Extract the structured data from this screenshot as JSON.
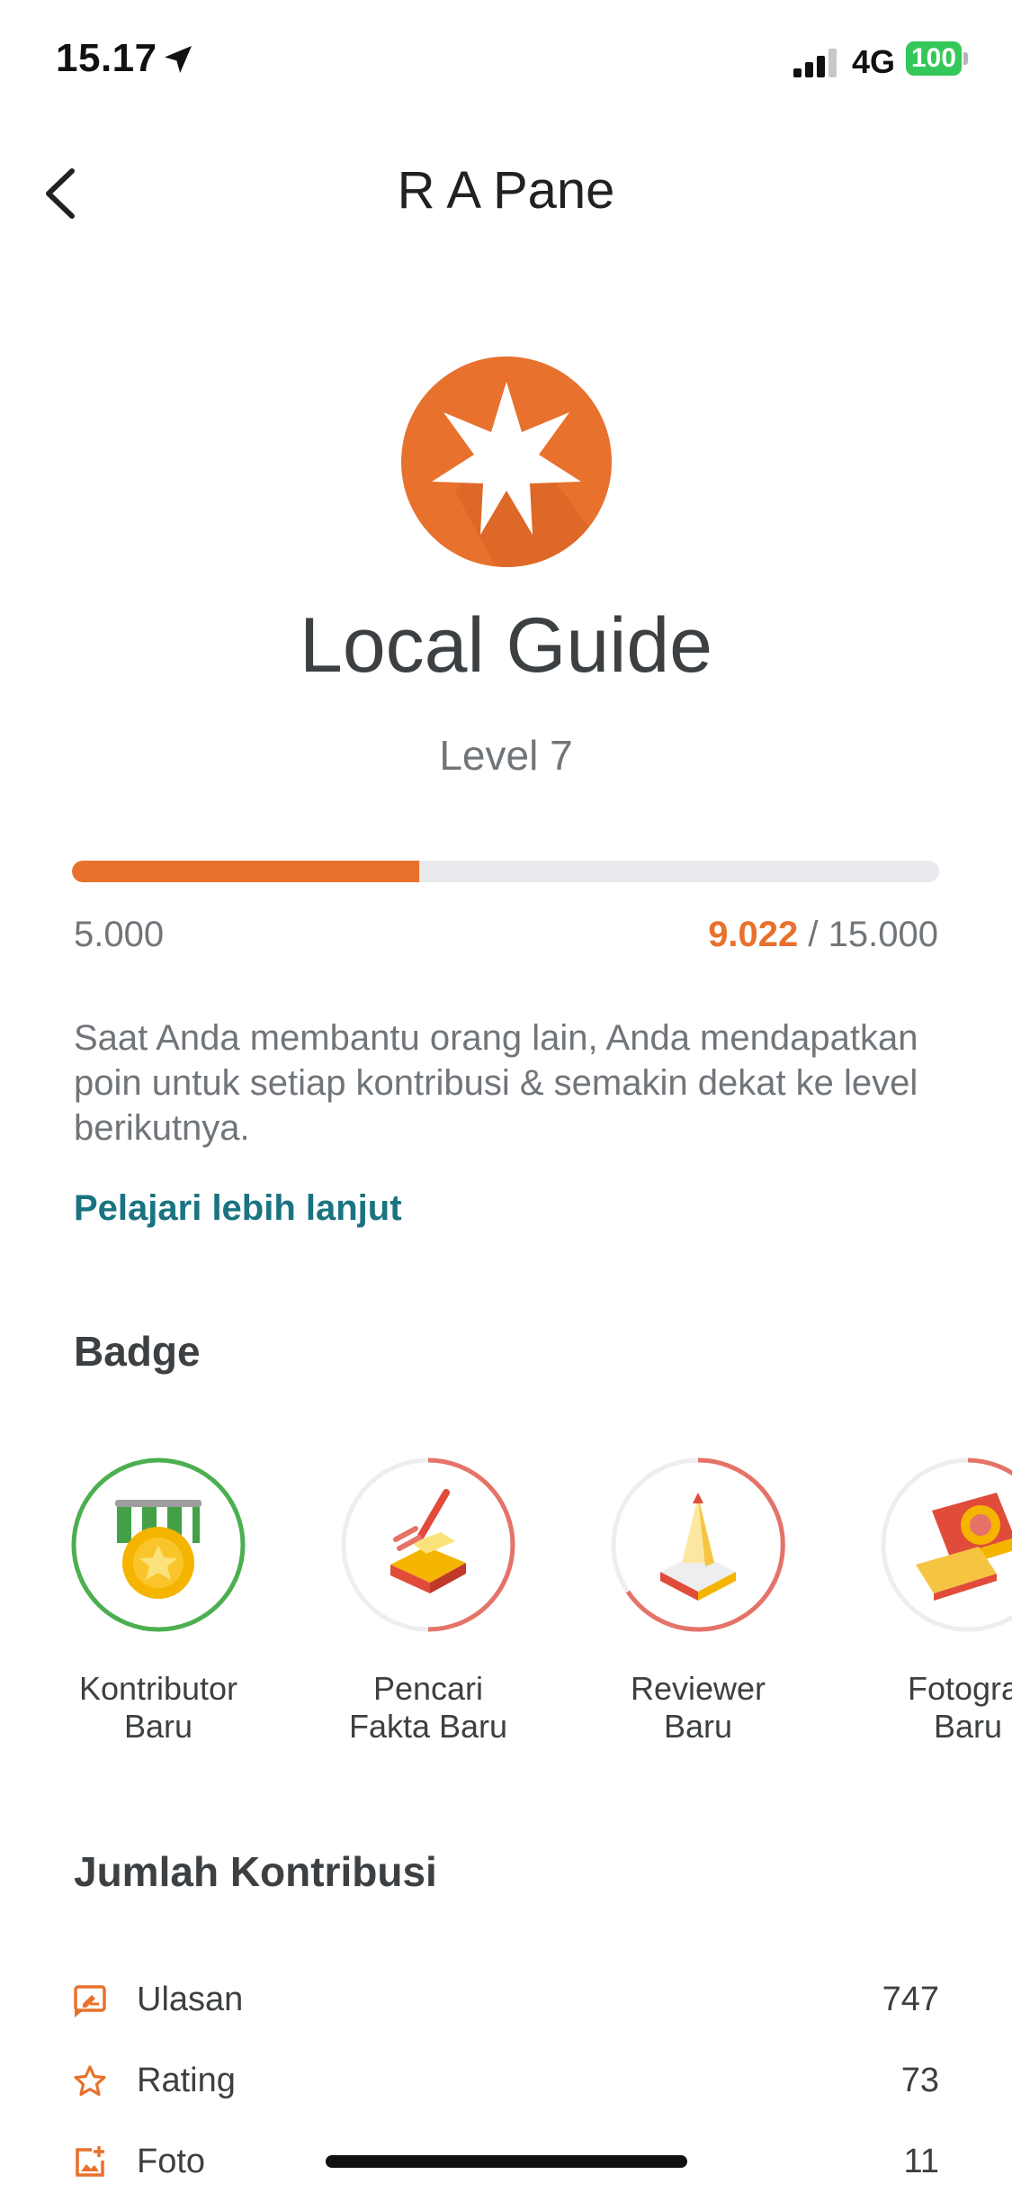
{
  "status_bar": {
    "time": "15.17",
    "network": "4G",
    "battery": "100"
  },
  "header": {
    "title": "R A Pane"
  },
  "level": {
    "title": "Local Guide",
    "level_label": "Level 7",
    "progress_min": "5.000",
    "progress_current": "9.022",
    "progress_max": "/ 15.000",
    "progress_fraction": 0.4,
    "description": "Saat Anda membantu orang lain, Anda mendapatkan poin untuk setiap kontribusi & semakin dekat ke level berikutnya.",
    "learn_more": "Pelajari lebih lanjut",
    "accent_color": "#e8712d"
  },
  "badges": {
    "title": "Badge",
    "items": [
      {
        "label": "Kontributor\nBaru"
      },
      {
        "label": "Pencari\nFakta Baru"
      },
      {
        "label": "Reviewer\nBaru"
      },
      {
        "label": "Fotograf\nBaru"
      }
    ]
  },
  "contributions": {
    "title": "Jumlah Kontribusi",
    "items": [
      {
        "icon": "review-icon",
        "label": "Ulasan",
        "value": "747"
      },
      {
        "icon": "star-icon",
        "label": "Rating",
        "value": "73"
      },
      {
        "icon": "add-photo-icon",
        "label": "Foto",
        "value": "11"
      }
    ]
  }
}
